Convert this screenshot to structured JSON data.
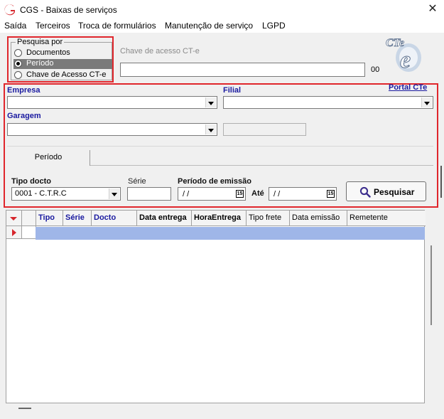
{
  "window": {
    "title": "CGS - Baixas de serviços",
    "close_symbol": "✕"
  },
  "menu": [
    "Saída",
    "Terceiros",
    "Troca de formulários",
    "Manutenção de serviço",
    "LGPD"
  ],
  "search_by": {
    "legend": "Pesquisa por",
    "options": [
      "Documentos",
      "Período",
      "Chave de Acesso CT-e"
    ],
    "selected": "Período"
  },
  "access_key": {
    "label": "Chave de acesso CT-e",
    "value": "",
    "dv_text": "00"
  },
  "logo": {
    "text": "CTe"
  },
  "filters": {
    "empresa_label": "Empresa",
    "empresa_value": "",
    "filial_label": "Filial",
    "filial_value": "",
    "garagem_label": "Garagem",
    "garagem_value": "",
    "portal_link": "Portal CTe"
  },
  "tab": {
    "label": "Período"
  },
  "criteria": {
    "tipo_docto_label": "Tipo docto",
    "tipo_docto_value": "0001 - C.T.R.C",
    "serie_label": "Série",
    "serie_value": "",
    "periodo_label": "Período de emissão",
    "date_from": " / /",
    "ate_label": "Até",
    "date_to": " / /",
    "calendar_glyph": "15",
    "search_button": "Pesquisar"
  },
  "grid": {
    "columns": [
      "Tipo",
      "Série",
      "Docto",
      "Data entrega",
      "HoraEntrega",
      "Tipo frete",
      "Data emissão",
      "Remetente"
    ]
  },
  "colors": {
    "highlight_red": "#e0262c",
    "label_blue": "#1a1aa0",
    "row_selected": "#9fb6e8"
  }
}
